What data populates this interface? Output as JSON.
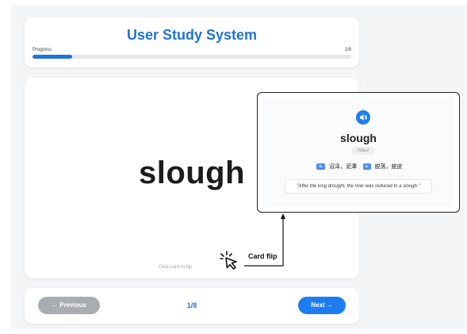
{
  "header": {
    "title": "User Study System",
    "progress_label": "Progress",
    "progress_count": "1/8",
    "progress_fraction": 0.125
  },
  "card": {
    "word": "slough",
    "click_hint": "Click card to flip"
  },
  "annotation": {
    "flip_label": "Card flip",
    "cursor_icon": "cursor-click-icon"
  },
  "popup": {
    "word": "slough",
    "phonetic": "/slaʊ/",
    "audio_icon": "speaker-icon",
    "definitions": [
      {
        "pos": "n.",
        "text": "沼泽，泥潭"
      },
      {
        "pos": "v.",
        "text": "脱落，蜕皮"
      }
    ],
    "example": "\"After the long drought, the river was reduced to a slough.\""
  },
  "nav": {
    "prev_label": "← Previous",
    "page": "1/8",
    "next_label": "Next →"
  },
  "colors": {
    "accent": "#1f73d6",
    "button_blue": "#1f7cf0",
    "disabled_gray": "#a9acb1"
  }
}
